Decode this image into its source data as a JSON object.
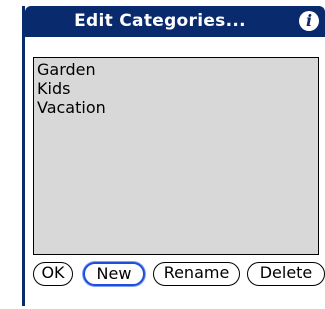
{
  "dialog": {
    "title": "Edit Categories...",
    "info_icon": "info-icon"
  },
  "categories": [
    {
      "label": "Garden"
    },
    {
      "label": "Kids"
    },
    {
      "label": "Vacation"
    }
  ],
  "buttons": {
    "ok": "OK",
    "new": "New",
    "rename": "Rename",
    "delete": "Delete",
    "selected": "new"
  },
  "colors": {
    "titlebar": "#0a2a6e",
    "list_background": "#d8d8d8",
    "focus_ring": "#1f4fd4"
  }
}
